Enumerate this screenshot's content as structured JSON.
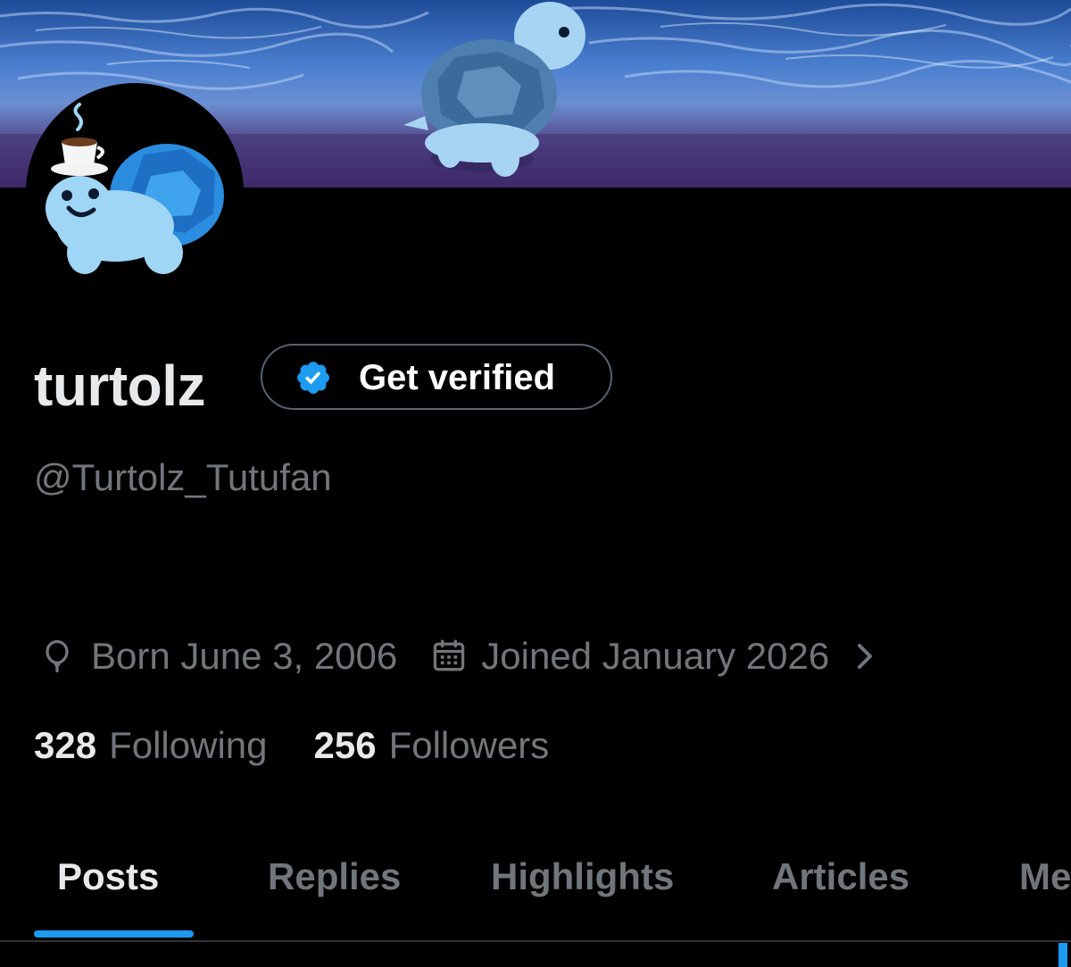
{
  "profile": {
    "display_name": "turtolz",
    "handle": "@Turtolz_Tutufan",
    "verify_button_label": "Get verified",
    "born": "Born June 3, 2006",
    "joined": "Joined January 2026",
    "following_count": "328",
    "following_label": "Following",
    "followers_count": "256",
    "followers_label": "Followers"
  },
  "tabs": [
    {
      "label": "Posts",
      "active": true
    },
    {
      "label": "Replies",
      "active": false
    },
    {
      "label": "Highlights",
      "active": false
    },
    {
      "label": "Articles",
      "active": false
    },
    {
      "label": "Me",
      "active": false
    }
  ],
  "icons": {
    "verify_badge": "verified-badge-icon",
    "born": "balloon-icon",
    "joined": "calendar-icon",
    "chevron": "chevron-right-icon"
  },
  "colors": {
    "background": "#000000",
    "text_primary": "#e7e9ea",
    "text_secondary": "#71767b",
    "accent": "#1d9bf0",
    "border": "#536471"
  }
}
